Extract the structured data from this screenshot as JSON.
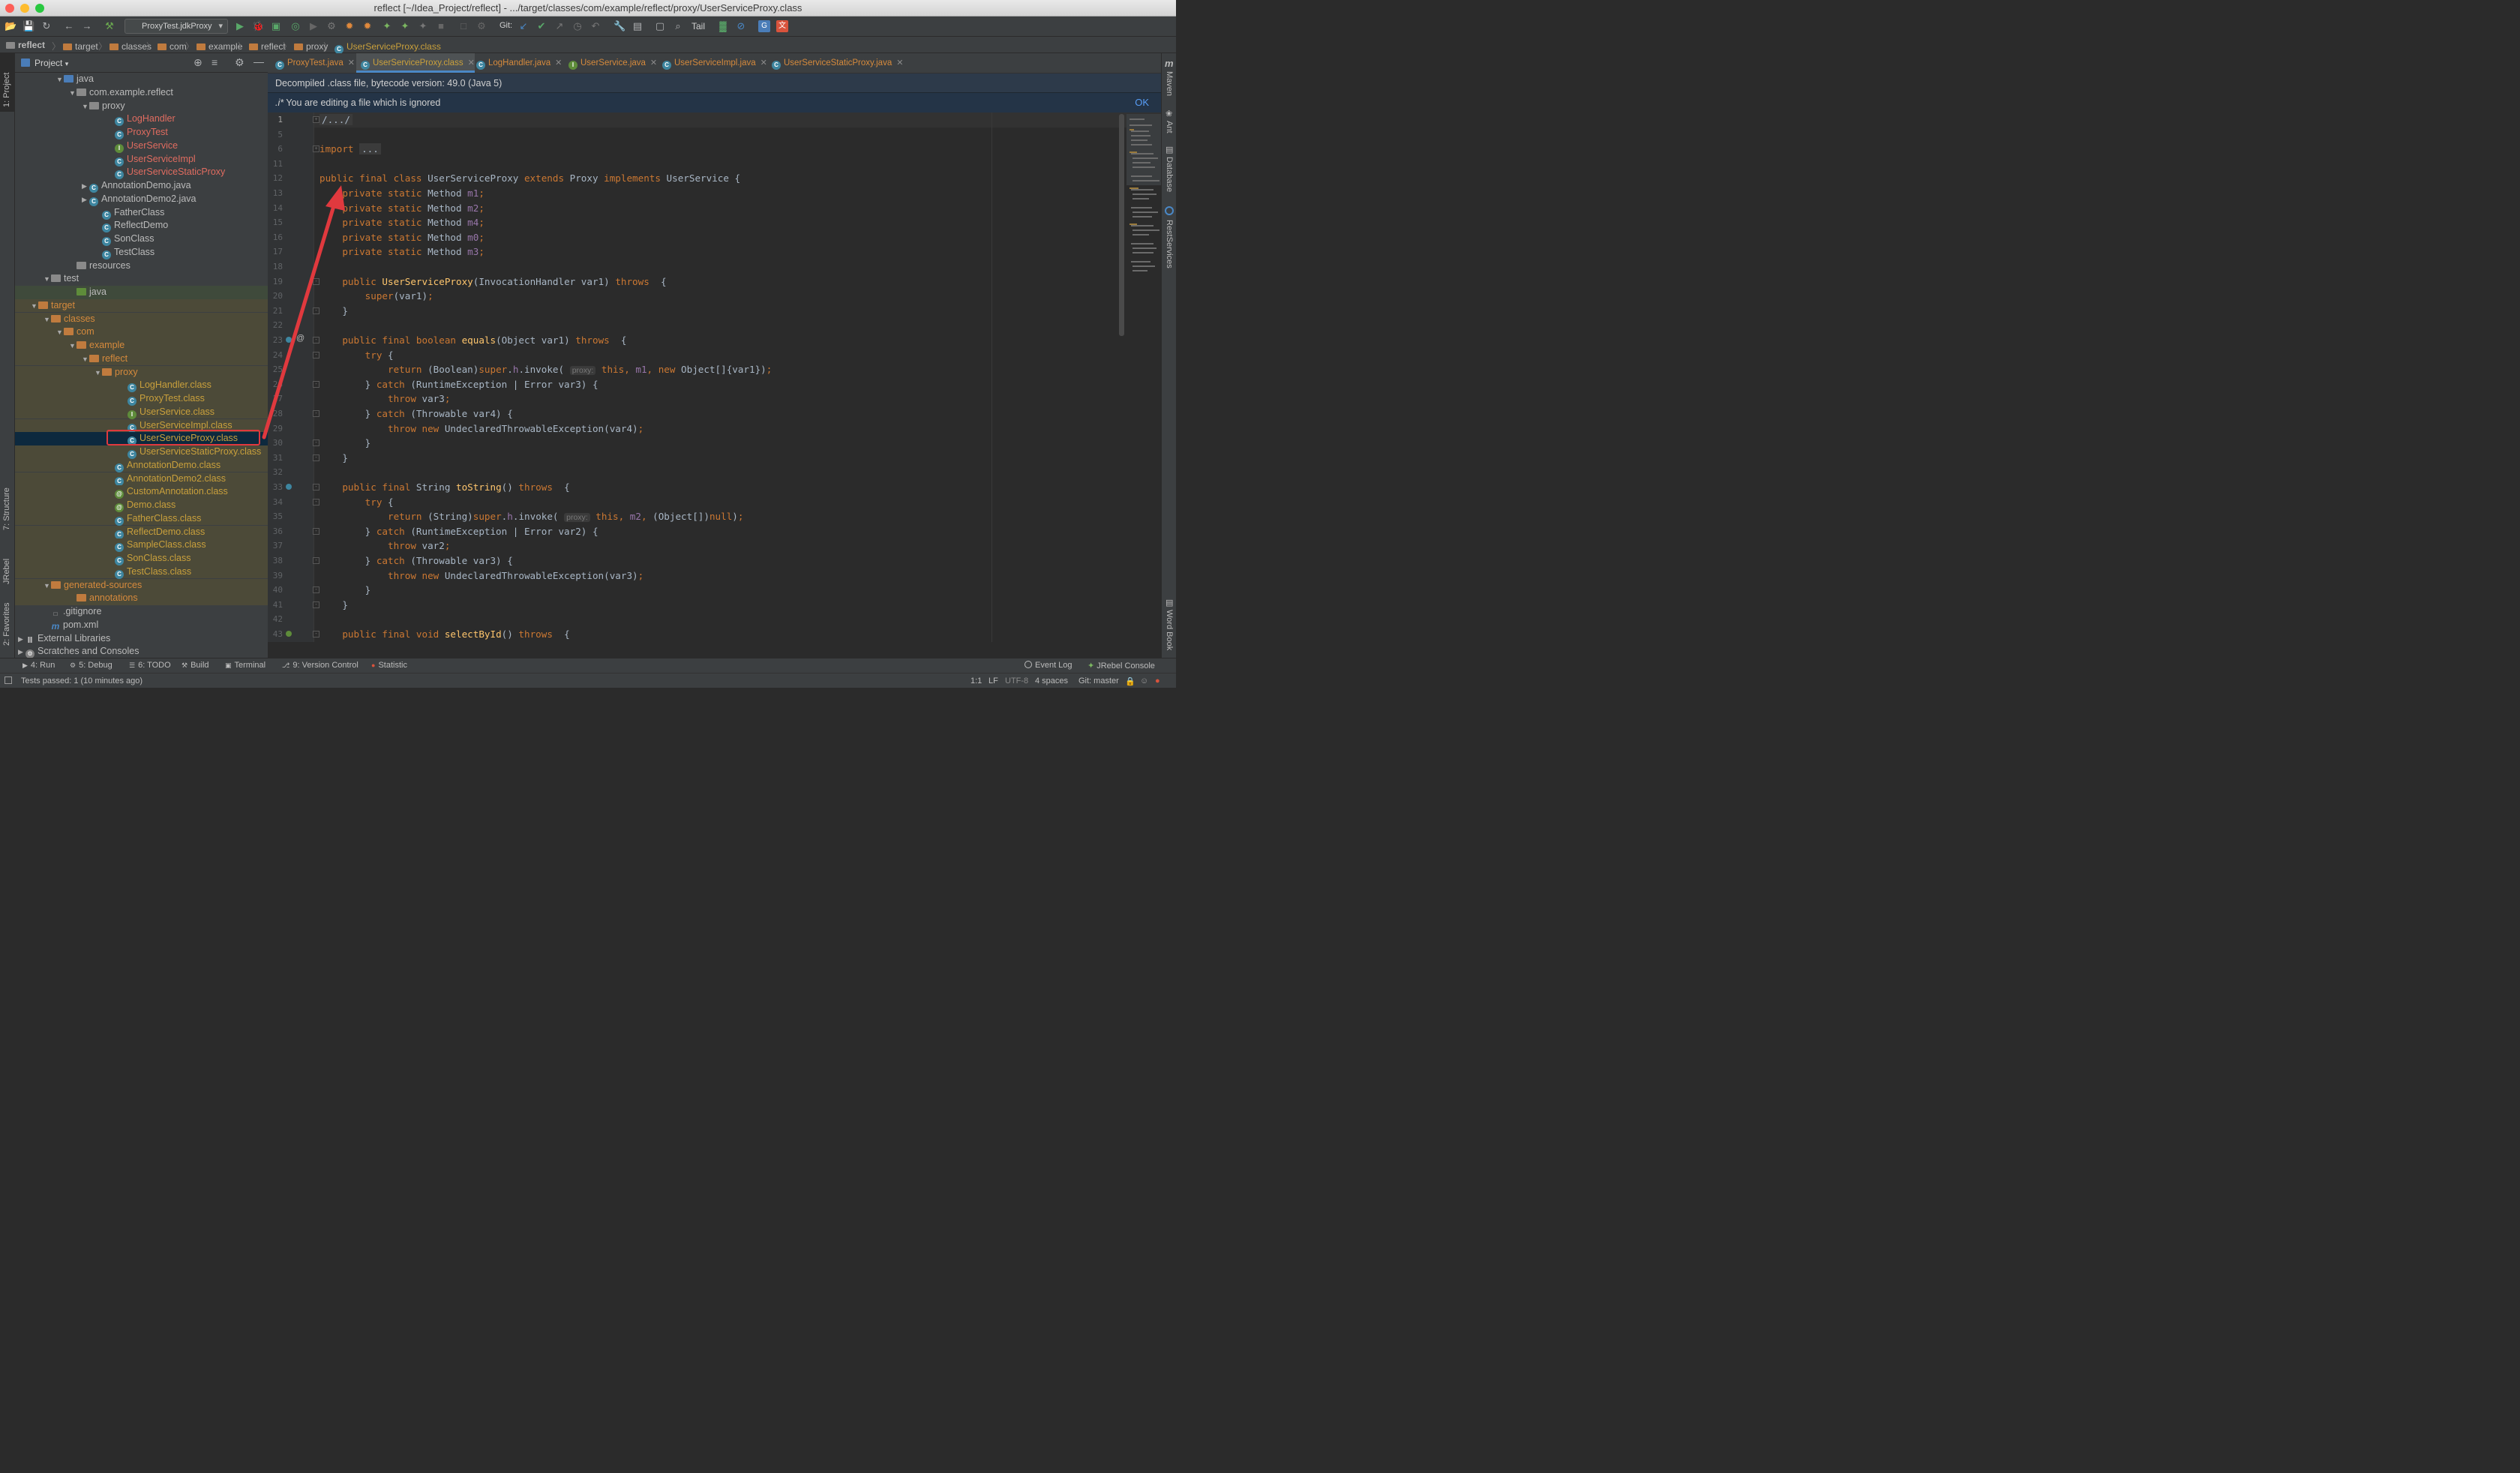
{
  "window": {
    "title": "reflect [~/Idea_Project/reflect] - .../target/classes/com/example/reflect/proxy/UserServiceProxy.class"
  },
  "toolbar": {
    "run_config": "ProxyTest.jdkProxy",
    "git_label": "Git:",
    "tail_label": "Tail"
  },
  "breadcrumb": [
    "reflect",
    "target",
    "classes",
    "com",
    "example",
    "reflect",
    "proxy",
    "UserServiceProxy.class"
  ],
  "project_panel": {
    "title": "Project"
  },
  "tree": [
    {
      "label": "java",
      "icon": "folder-blue",
      "depth": 3,
      "arrow": "open"
    },
    {
      "label": "com.example.reflect",
      "icon": "package",
      "depth": 4,
      "arrow": "open"
    },
    {
      "label": "proxy",
      "icon": "package",
      "depth": 5,
      "arrow": "open"
    },
    {
      "label": "LogHandler",
      "icon": "class",
      "depth": 7,
      "color": "#e06c60"
    },
    {
      "label": "ProxyTest",
      "icon": "class",
      "depth": 7,
      "color": "#e06c60"
    },
    {
      "label": "UserService",
      "icon": "interface",
      "depth": 7,
      "color": "#e06c60"
    },
    {
      "label": "UserServiceImpl",
      "icon": "class",
      "depth": 7,
      "color": "#e06c60"
    },
    {
      "label": "UserServiceStaticProxy",
      "icon": "class",
      "depth": 7,
      "color": "#e06c60"
    },
    {
      "label": "AnnotationDemo.java",
      "icon": "class",
      "depth": 5,
      "arrow": "closed"
    },
    {
      "label": "AnnotationDemo2.java",
      "icon": "class",
      "depth": 5,
      "arrow": "closed"
    },
    {
      "label": "FatherClass",
      "icon": "class",
      "depth": 6
    },
    {
      "label": "ReflectDemo",
      "icon": "class",
      "depth": 6
    },
    {
      "label": "SonClass",
      "icon": "class",
      "depth": 6
    },
    {
      "label": "TestClass",
      "icon": "class",
      "depth": 6
    },
    {
      "label": "resources",
      "icon": "folder-grey",
      "depth": 4
    },
    {
      "label": "test",
      "icon": "folder-grey",
      "depth": 2,
      "arrow": "open"
    },
    {
      "label": "java",
      "icon": "folder-green",
      "depth": 4,
      "bg": "green"
    },
    {
      "label": "target",
      "icon": "folder-orange",
      "depth": 1,
      "arrow": "open",
      "color": "#d68a3c",
      "bg": "excl"
    },
    {
      "label": "classes",
      "icon": "folder-orange",
      "depth": 2,
      "arrow": "open",
      "color": "#d68a3c",
      "bg": "excl"
    },
    {
      "label": "com",
      "icon": "folder-orange",
      "depth": 3,
      "arrow": "open",
      "color": "#d68a3c",
      "bg": "excl"
    },
    {
      "label": "example",
      "icon": "folder-orange",
      "depth": 4,
      "arrow": "open",
      "color": "#d68a3c",
      "bg": "excl"
    },
    {
      "label": "reflect",
      "icon": "folder-orange",
      "depth": 5,
      "arrow": "open",
      "color": "#d68a3c",
      "bg": "excl"
    },
    {
      "label": "proxy",
      "icon": "folder-orange",
      "depth": 6,
      "arrow": "open",
      "color": "#d68a3c",
      "bg": "excl"
    },
    {
      "label": "LogHandler.class",
      "icon": "class",
      "depth": 8,
      "color": "#c9a03c",
      "bg": "excl"
    },
    {
      "label": "ProxyTest.class",
      "icon": "class",
      "depth": 8,
      "color": "#c9a03c",
      "bg": "excl"
    },
    {
      "label": "UserService.class",
      "icon": "interface",
      "depth": 8,
      "color": "#c9a03c",
      "bg": "excl"
    },
    {
      "label": "UserServiceImpl.class",
      "icon": "class",
      "depth": 8,
      "color": "#c9a03c",
      "bg": "excl"
    },
    {
      "label": "UserServiceProxy.class",
      "icon": "class",
      "depth": 8,
      "color": "#c9a03c",
      "bg": "sel"
    },
    {
      "label": "UserServiceStaticProxy.class",
      "icon": "class",
      "depth": 8,
      "color": "#c9a03c",
      "bg": "excl"
    },
    {
      "label": "AnnotationDemo.class",
      "icon": "class",
      "depth": 7,
      "color": "#c9a03c",
      "bg": "excl"
    },
    {
      "label": "AnnotationDemo2.class",
      "icon": "class",
      "depth": 7,
      "color": "#c9a03c",
      "bg": "excl"
    },
    {
      "label": "CustomAnnotation.class",
      "icon": "annotation",
      "depth": 7,
      "color": "#c9a03c",
      "bg": "excl"
    },
    {
      "label": "Demo.class",
      "icon": "annotation",
      "depth": 7,
      "color": "#c9a03c",
      "bg": "excl"
    },
    {
      "label": "FatherClass.class",
      "icon": "class",
      "depth": 7,
      "color": "#c9a03c",
      "bg": "excl"
    },
    {
      "label": "ReflectDemo.class",
      "icon": "class",
      "depth": 7,
      "color": "#c9a03c",
      "bg": "excl"
    },
    {
      "label": "SampleClass.class",
      "icon": "class",
      "depth": 7,
      "color": "#c9a03c",
      "bg": "excl"
    },
    {
      "label": "SonClass.class",
      "icon": "class",
      "depth": 7,
      "color": "#c9a03c",
      "bg": "excl"
    },
    {
      "label": "TestClass.class",
      "icon": "class",
      "depth": 7,
      "color": "#c9a03c",
      "bg": "excl"
    },
    {
      "label": "generated-sources",
      "icon": "folder-orange",
      "depth": 2,
      "arrow": "open",
      "color": "#d68a3c",
      "bg": "excl"
    },
    {
      "label": "annotations",
      "icon": "folder-orange",
      "depth": 4,
      "color": "#d68a3c",
      "bg": "excl"
    },
    {
      "label": ".gitignore",
      "icon": "file",
      "depth": 2
    },
    {
      "label": "pom.xml",
      "icon": "maven",
      "depth": 2
    },
    {
      "label": "External Libraries",
      "icon": "library",
      "depth": 0,
      "arrow": "closed"
    },
    {
      "label": "Scratches and Consoles",
      "icon": "scratch",
      "depth": 0,
      "arrow": "closed"
    }
  ],
  "tabs": [
    {
      "label": "ProxyTest.java",
      "icon": "class"
    },
    {
      "label": "UserServiceProxy.class",
      "icon": "class",
      "active": true
    },
    {
      "label": "LogHandler.java",
      "icon": "class"
    },
    {
      "label": "UserService.java",
      "icon": "interface"
    },
    {
      "label": "UserServiceImpl.java",
      "icon": "class"
    },
    {
      "label": "UserServiceStaticProxy.java",
      "icon": "class"
    }
  ],
  "banners": {
    "decompiled": "Decompiled .class file, bytecode version: 49.0 (Java 5)",
    "ignored_prefix": ".i*",
    "ignored": "You are editing a file which is ignored",
    "ok": "OK"
  },
  "code_lines": [
    {
      "n": "1",
      "t": [
        [
          "fold",
          "/.../"
        ]
      ]
    },
    {
      "n": "5",
      "t": []
    },
    {
      "n": "6",
      "t": [
        [
          "kw",
          "import "
        ],
        [
          "fold",
          "..."
        ]
      ]
    },
    {
      "n": "11",
      "t": []
    },
    {
      "n": "12",
      "t": [
        [
          "kw",
          "public final class "
        ],
        [
          "p",
          "UserServiceProxy "
        ],
        [
          "kw",
          "extends "
        ],
        [
          "p",
          "Proxy "
        ],
        [
          "kw",
          "implements "
        ],
        [
          "p",
          "UserService {"
        ]
      ]
    },
    {
      "n": "13",
      "t": [
        [
          "p",
          "    "
        ],
        [
          "kw",
          "private static "
        ],
        [
          "p",
          "Method "
        ],
        [
          "fld",
          "m1"
        ],
        [
          "kw",
          ";"
        ]
      ]
    },
    {
      "n": "14",
      "t": [
        [
          "p",
          "    "
        ],
        [
          "kw",
          "private static "
        ],
        [
          "p",
          "Method "
        ],
        [
          "fld",
          "m2"
        ],
        [
          "kw",
          ";"
        ]
      ]
    },
    {
      "n": "15",
      "t": [
        [
          "p",
          "    "
        ],
        [
          "kw",
          "private static "
        ],
        [
          "p",
          "Method "
        ],
        [
          "fld",
          "m4"
        ],
        [
          "kw",
          ";"
        ]
      ]
    },
    {
      "n": "16",
      "t": [
        [
          "p",
          "    "
        ],
        [
          "kw",
          "private static "
        ],
        [
          "p",
          "Method "
        ],
        [
          "fld",
          "m0"
        ],
        [
          "kw",
          ";"
        ]
      ]
    },
    {
      "n": "17",
      "t": [
        [
          "p",
          "    "
        ],
        [
          "kw",
          "private static "
        ],
        [
          "p",
          "Method "
        ],
        [
          "fld",
          "m3"
        ],
        [
          "kw",
          ";"
        ]
      ]
    },
    {
      "n": "18",
      "t": []
    },
    {
      "n": "19",
      "t": [
        [
          "p",
          "    "
        ],
        [
          "kw",
          "public "
        ],
        [
          "mth",
          "UserServiceProxy"
        ],
        [
          "p",
          "(InvocationHandler var1) "
        ],
        [
          "kw",
          "throws "
        ],
        [
          "p",
          " {"
        ]
      ]
    },
    {
      "n": "20",
      "t": [
        [
          "p",
          "        "
        ],
        [
          "kw",
          "super"
        ],
        [
          "p",
          "(var1)"
        ],
        [
          "kw",
          ";"
        ]
      ]
    },
    {
      "n": "21",
      "t": [
        [
          "p",
          "    }"
        ]
      ]
    },
    {
      "n": "22",
      "t": []
    },
    {
      "n": "23",
      "t": [
        [
          "p",
          "    "
        ],
        [
          "kw",
          "public final boolean "
        ],
        [
          "mth",
          "equals"
        ],
        [
          "p",
          "(Object var1) "
        ],
        [
          "kw",
          "throws "
        ],
        [
          "p",
          " {"
        ]
      ]
    },
    {
      "n": "24",
      "t": [
        [
          "p",
          "        "
        ],
        [
          "kw",
          "try "
        ],
        [
          "p",
          "{"
        ]
      ]
    },
    {
      "n": "25",
      "t": [
        [
          "p",
          "            "
        ],
        [
          "kw",
          "return "
        ],
        [
          "p",
          "(Boolean)"
        ],
        [
          "kw",
          "super"
        ],
        [
          "p",
          "."
        ],
        [
          "fld",
          "h"
        ],
        [
          "p",
          ".invoke( "
        ],
        [
          "hint",
          "proxy:"
        ],
        [
          "kw",
          " this, "
        ],
        [
          "fld",
          "m1"
        ],
        [
          "kw",
          ", new "
        ],
        [
          "p",
          "Object[]{var1})"
        ],
        [
          "kw",
          ";"
        ]
      ]
    },
    {
      "n": "26",
      "t": [
        [
          "p",
          "        } "
        ],
        [
          "kw",
          "catch "
        ],
        [
          "p",
          "(RuntimeException | Error var3) {"
        ]
      ]
    },
    {
      "n": "27",
      "t": [
        [
          "p",
          "            "
        ],
        [
          "kw",
          "throw "
        ],
        [
          "p",
          "var3"
        ],
        [
          "kw",
          ";"
        ]
      ]
    },
    {
      "n": "28",
      "t": [
        [
          "p",
          "        } "
        ],
        [
          "kw",
          "catch "
        ],
        [
          "p",
          "(Throwable var4) {"
        ]
      ]
    },
    {
      "n": "29",
      "t": [
        [
          "p",
          "            "
        ],
        [
          "kw",
          "throw new "
        ],
        [
          "p",
          "UndeclaredThrowableException(var4)"
        ],
        [
          "kw",
          ";"
        ]
      ]
    },
    {
      "n": "30",
      "t": [
        [
          "p",
          "        }"
        ]
      ]
    },
    {
      "n": "31",
      "t": [
        [
          "p",
          "    }"
        ]
      ]
    },
    {
      "n": "32",
      "t": []
    },
    {
      "n": "33",
      "t": [
        [
          "p",
          "    "
        ],
        [
          "kw",
          "public final "
        ],
        [
          "p",
          "String "
        ],
        [
          "mth",
          "toString"
        ],
        [
          "p",
          "() "
        ],
        [
          "kw",
          "throws "
        ],
        [
          "p",
          " {"
        ]
      ]
    },
    {
      "n": "34",
      "t": [
        [
          "p",
          "        "
        ],
        [
          "kw",
          "try "
        ],
        [
          "p",
          "{"
        ]
      ]
    },
    {
      "n": "35",
      "t": [
        [
          "p",
          "            "
        ],
        [
          "kw",
          "return "
        ],
        [
          "p",
          "(String)"
        ],
        [
          "kw",
          "super"
        ],
        [
          "p",
          "."
        ],
        [
          "fld",
          "h"
        ],
        [
          "p",
          ".invoke( "
        ],
        [
          "hint",
          "proxy:"
        ],
        [
          "kw",
          " this, "
        ],
        [
          "fld",
          "m2"
        ],
        [
          "kw",
          ", "
        ],
        [
          "p",
          "(Object[])"
        ],
        [
          "kw",
          "null"
        ],
        [
          "p",
          ")"
        ],
        [
          "kw",
          ";"
        ]
      ]
    },
    {
      "n": "36",
      "t": [
        [
          "p",
          "        } "
        ],
        [
          "kw",
          "catch "
        ],
        [
          "p",
          "(RuntimeException | Error var2) {"
        ]
      ]
    },
    {
      "n": "37",
      "t": [
        [
          "p",
          "            "
        ],
        [
          "kw",
          "throw "
        ],
        [
          "p",
          "var2"
        ],
        [
          "kw",
          ";"
        ]
      ]
    },
    {
      "n": "38",
      "t": [
        [
          "p",
          "        } "
        ],
        [
          "kw",
          "catch "
        ],
        [
          "p",
          "(Throwable var3) {"
        ]
      ]
    },
    {
      "n": "39",
      "t": [
        [
          "p",
          "            "
        ],
        [
          "kw",
          "throw new "
        ],
        [
          "p",
          "UndeclaredThrowableException(var3)"
        ],
        [
          "kw",
          ";"
        ]
      ]
    },
    {
      "n": "40",
      "t": [
        [
          "p",
          "        }"
        ]
      ]
    },
    {
      "n": "41",
      "t": [
        [
          "p",
          "    }"
        ]
      ]
    },
    {
      "n": "42",
      "t": []
    },
    {
      "n": "43",
      "t": [
        [
          "p",
          "    "
        ],
        [
          "kw",
          "public final void "
        ],
        [
          "mth",
          "selectById"
        ],
        [
          "p",
          "() "
        ],
        [
          "kw",
          "throws "
        ],
        [
          "p",
          " {"
        ]
      ]
    }
  ],
  "left_strip": {
    "project": "1: Project",
    "structure": "7: Structure",
    "jrebel": "JRebel",
    "favorites": "2: Favorites"
  },
  "right_strip": {
    "maven": "Maven",
    "ant": "Ant",
    "database": "Database",
    "restservices": "RestServices",
    "wordbook": "Word Book"
  },
  "bottom_tools": [
    {
      "label": "4: Run",
      "icon": "run-icon"
    },
    {
      "label": "5: Debug",
      "icon": "debug-icon"
    },
    {
      "label": "6: TODO",
      "icon": "todo-icon"
    },
    {
      "label": "Build",
      "icon": "build-icon"
    },
    {
      "label": "Terminal",
      "icon": "terminal-icon"
    },
    {
      "label": "9: Version Control",
      "icon": "vcs-icon"
    },
    {
      "label": "Statistic",
      "icon": "statistic-icon"
    }
  ],
  "bottom_right": {
    "event_log": "Event Log",
    "jrebel_console": "JRebel Console"
  },
  "status": {
    "message": "Tests passed: 1 (10 minutes ago)",
    "position": "1:1",
    "line_sep": "LF",
    "encoding": "UTF-8",
    "indent": "4 spaces",
    "git": "Git: master"
  },
  "colors": {
    "accent": "#4a88c7",
    "callout": "#e0393e",
    "excluded_bg": "#4c4a38",
    "selected_bg": "#0d293e"
  }
}
